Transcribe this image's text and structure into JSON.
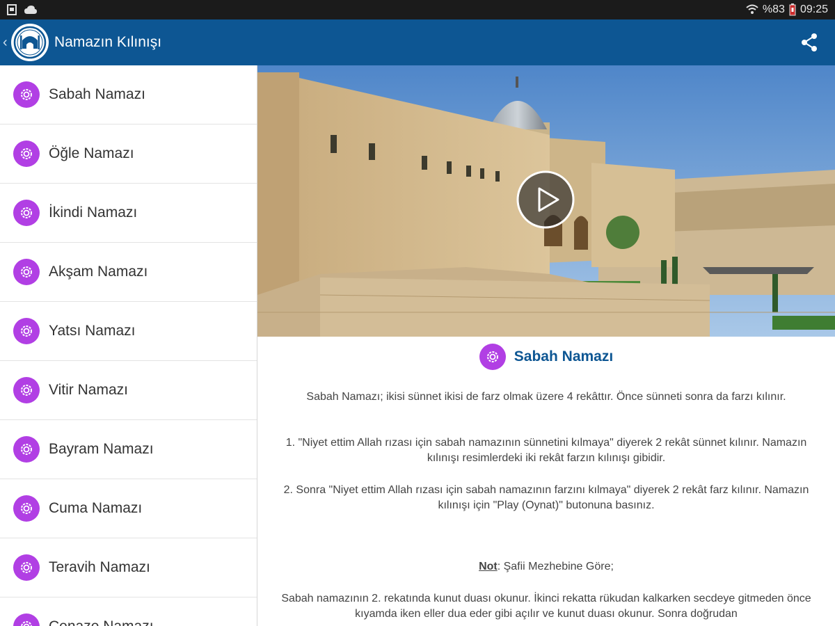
{
  "status_bar": {
    "battery": "%83",
    "time": "09:25"
  },
  "header": {
    "title": "Namazın Kılınışı",
    "icons": [
      "back-chevron-icon",
      "mosque-logo-icon",
      "share-icon"
    ]
  },
  "sidebar": {
    "items": [
      {
        "label": "Sabah Namazı"
      },
      {
        "label": "Öğle Namazı"
      },
      {
        "label": "İkindi Namazı"
      },
      {
        "label": "Akşam Namazı"
      },
      {
        "label": "Yatsı Namazı"
      },
      {
        "label": "Vitir Namazı"
      },
      {
        "label": "Bayram Namazı"
      },
      {
        "label": "Cuma Namazı"
      },
      {
        "label": "Teravih Namazı"
      },
      {
        "label": "Cenaze Namazı"
      }
    ]
  },
  "detail": {
    "title": "Sabah Namazı",
    "para1": "Sabah Namazı; ikisi sünnet ikisi de farz olmak üzere 4 rekâttır. Önce sünneti sonra da farzı kılınır.",
    "para2": "1. \"Niyet ettim Allah rızası için sabah namazının sünnetini kılmaya\" diyerek 2 rekât sünnet kılınır. Namazın kılınışı resimlerdeki iki rekât farzın kılınışı gibidir.",
    "para3": "2. Sonra \"Niyet ettim Allah rızası için sabah namazının farzını kılmaya\" diyerek 2 rekât farz kılınır. Namazın kılınışı için \"Play (Oynat)\" butonuna basınız.",
    "note_label": "Not",
    "note_text": ": Şafii Mezhebine Göre;",
    "para4": "Sabah namazının 2. rekatında kunut duası okunur. İkinci rekatta rükudan kalkarken secdeye gitmeden önce kıyamda iken eller dua eder gibi açılır ve kunut duası okunur. Sonra doğrudan"
  },
  "colors": {
    "app_bar": "#0d5693",
    "accent_purple": "#b13fe4",
    "title_blue": "#0d5693"
  }
}
